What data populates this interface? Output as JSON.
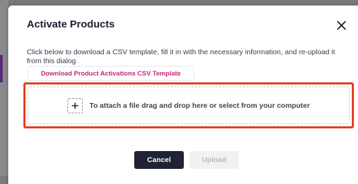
{
  "dialog": {
    "title": "Activate Products",
    "close_icon": "close-icon",
    "description": "Click below to download a CSV template, fill it in with the necessary information, and re-upload it from this dialog",
    "download_button_label": "Download Product Activations CSV Template",
    "dropzone": {
      "icon": "plus-icon",
      "text": "To attach a file drag and drop here or select from your computer"
    },
    "cancel_label": "Cancel",
    "upload_label": "Upload",
    "upload_disabled": true
  },
  "colors": {
    "accent_pink": "#c4267c",
    "highlight_red": "#e83a1e",
    "primary_dark": "#1f2333",
    "disabled_bg": "#f1f1f4"
  }
}
